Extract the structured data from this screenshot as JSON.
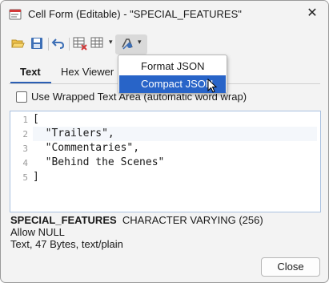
{
  "window": {
    "title": "Cell Form (Editable) - \"SPECIAL_FEATURES\"",
    "close_glyph": "✕"
  },
  "toolbar": {
    "buttons": [
      "open-icon",
      "save-icon",
      "undo-icon",
      "grid-delete-icon",
      "grid-options-icon",
      "format-icon"
    ]
  },
  "tabs": [
    {
      "label": "Text",
      "active": true
    },
    {
      "label": "Hex Viewer",
      "active": false
    }
  ],
  "wrap_option": {
    "label": "Use Wrapped Text Area (automatic word wrap)",
    "checked": false
  },
  "editor": {
    "line_numbers": [
      "1",
      "2",
      "3",
      "4",
      "5"
    ],
    "lines": [
      "[",
      "  \"Trailers\",",
      "  \"Commentaries\",",
      "  \"Behind the Scenes\"",
      "]"
    ]
  },
  "column_info": {
    "name": "SPECIAL_FEATURES",
    "type": "CHARACTER VARYING (256)",
    "nullability": "Allow NULL",
    "details": "Text, 47 Bytes, text/plain"
  },
  "menu": {
    "items": [
      {
        "label": "Format JSON",
        "selected": false
      },
      {
        "label": "Compact JSON",
        "selected": true
      }
    ]
  },
  "buttons": {
    "close": "Close"
  },
  "colors": {
    "accent": "#2864c8",
    "tab_underline": "#2b5fb4"
  }
}
